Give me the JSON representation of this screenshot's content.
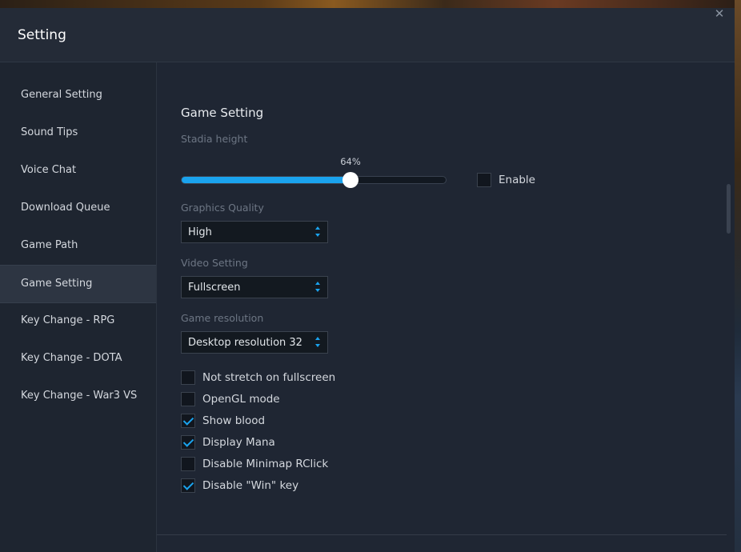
{
  "window": {
    "title": "Setting"
  },
  "sidebar": {
    "items": [
      {
        "label": "General Setting",
        "active": false
      },
      {
        "label": "Sound Tips",
        "active": false
      },
      {
        "label": "Voice Chat",
        "active": false
      },
      {
        "label": "Download Queue",
        "active": false
      },
      {
        "label": "Game Path",
        "active": false
      },
      {
        "label": "Game Setting",
        "active": true
      },
      {
        "label": "Key Change - RPG",
        "active": false
      },
      {
        "label": "Key Change - DOTA",
        "active": false
      },
      {
        "label": "Key Change - War3 VS",
        "active": false
      }
    ]
  },
  "game_setting": {
    "title": "Game Setting",
    "stadia_height": {
      "label": "Stadia height",
      "value": 64,
      "value_label": "64%",
      "enable_label": "Enable",
      "enabled": false
    },
    "graphics_quality": {
      "label": "Graphics Quality",
      "value": "High"
    },
    "video_setting": {
      "label": "Video Setting",
      "value": "Fullscreen"
    },
    "game_resolution": {
      "label": "Game resolution",
      "value": "Desktop resolution 32"
    },
    "options": [
      {
        "label": "Not stretch on fullscreen",
        "checked": false
      },
      {
        "label": "OpenGL mode",
        "checked": false
      },
      {
        "label": "Show blood",
        "checked": true
      },
      {
        "label": "Display Mana",
        "checked": true
      },
      {
        "label": "Disable Minimap RClick",
        "checked": false
      },
      {
        "label": "Disable \"Win\" key",
        "checked": true
      }
    ]
  },
  "colors": {
    "accent": "#1aa3ee",
    "panel": "#1f2633",
    "sidebar": "#1e2530",
    "active_item": "#2d3542"
  },
  "icons": {
    "close": "close-icon",
    "select_arrows": "updown-arrows-icon",
    "check": "check-icon"
  }
}
